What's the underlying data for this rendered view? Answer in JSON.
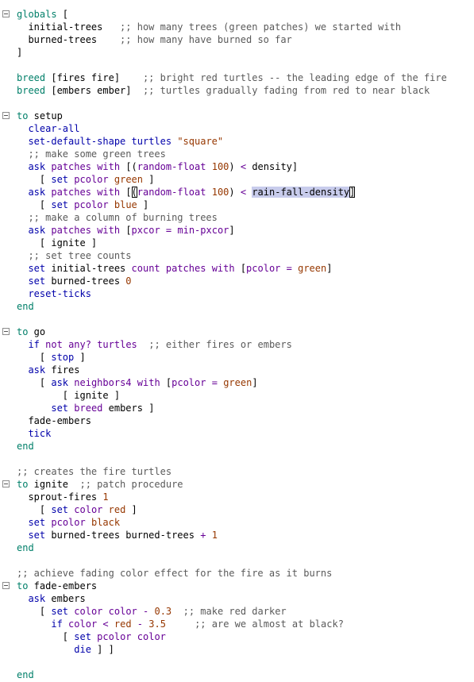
{
  "editor": {
    "colors": {
      "keyword": "#007f69",
      "command": "#0000aa",
      "reporter": "#660096",
      "constant": "#963700",
      "comment": "#5a5a5a",
      "text": "#000000",
      "selection": "#c8ccec"
    },
    "lines": [
      {
        "fold": true,
        "tokens": [
          {
            "t": "kw",
            "s": "globals"
          },
          {
            "t": "text",
            "s": " ["
          }
        ]
      },
      {
        "tokens": [
          {
            "t": "text",
            "s": "  initial-trees   "
          },
          {
            "t": "comment",
            "s": ";; how many trees (green patches) we started with"
          }
        ]
      },
      {
        "tokens": [
          {
            "t": "text",
            "s": "  burned-trees    "
          },
          {
            "t": "comment",
            "s": ";; how many have burned so far"
          }
        ]
      },
      {
        "tokens": [
          {
            "t": "text",
            "s": "]"
          }
        ]
      },
      {
        "tokens": []
      },
      {
        "tokens": [
          {
            "t": "kw",
            "s": "breed"
          },
          {
            "t": "text",
            "s": " [fires fire]    "
          },
          {
            "t": "comment",
            "s": ";; bright red turtles -- the leading edge of the fire"
          }
        ]
      },
      {
        "tokens": [
          {
            "t": "kw",
            "s": "breed"
          },
          {
            "t": "text",
            "s": " [embers ember]  "
          },
          {
            "t": "comment",
            "s": ";; turtles gradually fading from red to near black"
          }
        ]
      },
      {
        "tokens": []
      },
      {
        "fold": true,
        "tokens": [
          {
            "t": "kw",
            "s": "to"
          },
          {
            "t": "text",
            "s": " setup"
          }
        ]
      },
      {
        "tokens": [
          {
            "t": "text",
            "s": "  "
          },
          {
            "t": "cmd",
            "s": "clear-all"
          }
        ]
      },
      {
        "tokens": [
          {
            "t": "text",
            "s": "  "
          },
          {
            "t": "cmd",
            "s": "set-default-shape"
          },
          {
            "t": "text",
            "s": " "
          },
          {
            "t": "cmd",
            "s": "turtles"
          },
          {
            "t": "text",
            "s": " "
          },
          {
            "t": "const",
            "s": "\"square\""
          }
        ]
      },
      {
        "tokens": [
          {
            "t": "text",
            "s": "  "
          },
          {
            "t": "comment",
            "s": ";; make some green trees"
          }
        ]
      },
      {
        "tokens": [
          {
            "t": "text",
            "s": "  "
          },
          {
            "t": "cmd",
            "s": "ask"
          },
          {
            "t": "text",
            "s": " "
          },
          {
            "t": "rep",
            "s": "patches"
          },
          {
            "t": "text",
            "s": " "
          },
          {
            "t": "rep",
            "s": "with"
          },
          {
            "t": "text",
            "s": " [("
          },
          {
            "t": "rep",
            "s": "random-float"
          },
          {
            "t": "text",
            "s": " "
          },
          {
            "t": "const",
            "s": "100"
          },
          {
            "t": "text",
            "s": ") "
          },
          {
            "t": "rep",
            "s": "<"
          },
          {
            "t": "text",
            "s": " density]"
          }
        ]
      },
      {
        "tokens": [
          {
            "t": "text",
            "s": "    [ "
          },
          {
            "t": "cmd",
            "s": "set"
          },
          {
            "t": "text",
            "s": " "
          },
          {
            "t": "rep",
            "s": "pcolor"
          },
          {
            "t": "text",
            "s": " "
          },
          {
            "t": "const",
            "s": "green"
          },
          {
            "t": "text",
            "s": " ]"
          }
        ]
      },
      {
        "tokens": [
          {
            "t": "text",
            "s": "  "
          },
          {
            "t": "cmd",
            "s": "ask"
          },
          {
            "t": "text",
            "s": " "
          },
          {
            "t": "rep",
            "s": "patches"
          },
          {
            "t": "text",
            "s": " "
          },
          {
            "t": "rep",
            "s": "with"
          },
          {
            "t": "text",
            "s": " ["
          },
          {
            "t": "match",
            "s": "("
          },
          {
            "t": "rep",
            "s": "random-float"
          },
          {
            "t": "text",
            "s": " "
          },
          {
            "t": "const",
            "s": "100"
          },
          {
            "t": "text",
            "s": ") "
          },
          {
            "t": "rep",
            "s": "<"
          },
          {
            "t": "text",
            "s": " "
          },
          {
            "t": "sel",
            "s": "rain-fall-density"
          },
          {
            "t": "match",
            "s": "]"
          }
        ]
      },
      {
        "tokens": [
          {
            "t": "text",
            "s": "    [ "
          },
          {
            "t": "cmd",
            "s": "set"
          },
          {
            "t": "text",
            "s": " "
          },
          {
            "t": "rep",
            "s": "pcolor"
          },
          {
            "t": "text",
            "s": " "
          },
          {
            "t": "const",
            "s": "blue"
          },
          {
            "t": "text",
            "s": " ]"
          }
        ]
      },
      {
        "tokens": [
          {
            "t": "text",
            "s": "  "
          },
          {
            "t": "comment",
            "s": ";; make a column of burning trees"
          }
        ]
      },
      {
        "tokens": [
          {
            "t": "text",
            "s": "  "
          },
          {
            "t": "cmd",
            "s": "ask"
          },
          {
            "t": "text",
            "s": " "
          },
          {
            "t": "rep",
            "s": "patches"
          },
          {
            "t": "text",
            "s": " "
          },
          {
            "t": "rep",
            "s": "with"
          },
          {
            "t": "text",
            "s": " ["
          },
          {
            "t": "rep",
            "s": "pxcor"
          },
          {
            "t": "text",
            "s": " "
          },
          {
            "t": "rep",
            "s": "="
          },
          {
            "t": "text",
            "s": " "
          },
          {
            "t": "rep",
            "s": "min-pxcor"
          },
          {
            "t": "text",
            "s": "]"
          }
        ]
      },
      {
        "tokens": [
          {
            "t": "text",
            "s": "    [ ignite ]"
          }
        ]
      },
      {
        "tokens": [
          {
            "t": "text",
            "s": "  "
          },
          {
            "t": "comment",
            "s": ";; set tree counts"
          }
        ]
      },
      {
        "tokens": [
          {
            "t": "text",
            "s": "  "
          },
          {
            "t": "cmd",
            "s": "set"
          },
          {
            "t": "text",
            "s": " initial-trees "
          },
          {
            "t": "rep",
            "s": "count"
          },
          {
            "t": "text",
            "s": " "
          },
          {
            "t": "rep",
            "s": "patches"
          },
          {
            "t": "text",
            "s": " "
          },
          {
            "t": "rep",
            "s": "with"
          },
          {
            "t": "text",
            "s": " ["
          },
          {
            "t": "rep",
            "s": "pcolor"
          },
          {
            "t": "text",
            "s": " "
          },
          {
            "t": "rep",
            "s": "="
          },
          {
            "t": "text",
            "s": " "
          },
          {
            "t": "const",
            "s": "green"
          },
          {
            "t": "text",
            "s": "]"
          }
        ]
      },
      {
        "tokens": [
          {
            "t": "text",
            "s": "  "
          },
          {
            "t": "cmd",
            "s": "set"
          },
          {
            "t": "text",
            "s": " burned-trees "
          },
          {
            "t": "const",
            "s": "0"
          }
        ]
      },
      {
        "tokens": [
          {
            "t": "text",
            "s": "  "
          },
          {
            "t": "cmd",
            "s": "reset-ticks"
          }
        ]
      },
      {
        "tokens": [
          {
            "t": "kw",
            "s": "end"
          }
        ]
      },
      {
        "tokens": []
      },
      {
        "fold": true,
        "tokens": [
          {
            "t": "kw",
            "s": "to"
          },
          {
            "t": "text",
            "s": " go"
          }
        ]
      },
      {
        "tokens": [
          {
            "t": "text",
            "s": "  "
          },
          {
            "t": "cmd",
            "s": "if"
          },
          {
            "t": "text",
            "s": " "
          },
          {
            "t": "rep",
            "s": "not"
          },
          {
            "t": "text",
            "s": " "
          },
          {
            "t": "rep",
            "s": "any?"
          },
          {
            "t": "text",
            "s": " "
          },
          {
            "t": "rep",
            "s": "turtles"
          },
          {
            "t": "text",
            "s": "  "
          },
          {
            "t": "comment",
            "s": ";; either fires or embers"
          }
        ]
      },
      {
        "tokens": [
          {
            "t": "text",
            "s": "    [ "
          },
          {
            "t": "cmd",
            "s": "stop"
          },
          {
            "t": "text",
            "s": " ]"
          }
        ]
      },
      {
        "tokens": [
          {
            "t": "text",
            "s": "  "
          },
          {
            "t": "cmd",
            "s": "ask"
          },
          {
            "t": "text",
            "s": " fires"
          }
        ]
      },
      {
        "tokens": [
          {
            "t": "text",
            "s": "    [ "
          },
          {
            "t": "cmd",
            "s": "ask"
          },
          {
            "t": "text",
            "s": " "
          },
          {
            "t": "rep",
            "s": "neighbors4"
          },
          {
            "t": "text",
            "s": " "
          },
          {
            "t": "rep",
            "s": "with"
          },
          {
            "t": "text",
            "s": " ["
          },
          {
            "t": "rep",
            "s": "pcolor"
          },
          {
            "t": "text",
            "s": " "
          },
          {
            "t": "rep",
            "s": "="
          },
          {
            "t": "text",
            "s": " "
          },
          {
            "t": "const",
            "s": "green"
          },
          {
            "t": "text",
            "s": "]"
          }
        ]
      },
      {
        "tokens": [
          {
            "t": "text",
            "s": "        [ ignite ]"
          }
        ]
      },
      {
        "tokens": [
          {
            "t": "text",
            "s": "      "
          },
          {
            "t": "cmd",
            "s": "set"
          },
          {
            "t": "text",
            "s": " "
          },
          {
            "t": "rep",
            "s": "breed"
          },
          {
            "t": "text",
            "s": " embers ]"
          }
        ]
      },
      {
        "tokens": [
          {
            "t": "text",
            "s": "  fade-embers"
          }
        ]
      },
      {
        "tokens": [
          {
            "t": "text",
            "s": "  "
          },
          {
            "t": "cmd",
            "s": "tick"
          }
        ]
      },
      {
        "tokens": [
          {
            "t": "kw",
            "s": "end"
          }
        ]
      },
      {
        "tokens": []
      },
      {
        "tokens": [
          {
            "t": "comment",
            "s": ";; creates the fire turtles"
          }
        ]
      },
      {
        "fold": true,
        "tokens": [
          {
            "t": "kw",
            "s": "to"
          },
          {
            "t": "text",
            "s": " ignite  "
          },
          {
            "t": "comment",
            "s": ";; patch procedure"
          }
        ]
      },
      {
        "tokens": [
          {
            "t": "text",
            "s": "  sprout-fires "
          },
          {
            "t": "const",
            "s": "1"
          }
        ]
      },
      {
        "tokens": [
          {
            "t": "text",
            "s": "    [ "
          },
          {
            "t": "cmd",
            "s": "set"
          },
          {
            "t": "text",
            "s": " "
          },
          {
            "t": "rep",
            "s": "color"
          },
          {
            "t": "text",
            "s": " "
          },
          {
            "t": "const",
            "s": "red"
          },
          {
            "t": "text",
            "s": " ]"
          }
        ]
      },
      {
        "tokens": [
          {
            "t": "text",
            "s": "  "
          },
          {
            "t": "cmd",
            "s": "set"
          },
          {
            "t": "text",
            "s": " "
          },
          {
            "t": "rep",
            "s": "pcolor"
          },
          {
            "t": "text",
            "s": " "
          },
          {
            "t": "const",
            "s": "black"
          }
        ]
      },
      {
        "tokens": [
          {
            "t": "text",
            "s": "  "
          },
          {
            "t": "cmd",
            "s": "set"
          },
          {
            "t": "text",
            "s": " burned-trees burned-trees "
          },
          {
            "t": "rep",
            "s": "+"
          },
          {
            "t": "text",
            "s": " "
          },
          {
            "t": "const",
            "s": "1"
          }
        ]
      },
      {
        "tokens": [
          {
            "t": "kw",
            "s": "end"
          }
        ]
      },
      {
        "tokens": []
      },
      {
        "tokens": [
          {
            "t": "comment",
            "s": ";; achieve fading color effect for the fire as it burns"
          }
        ]
      },
      {
        "fold": true,
        "tokens": [
          {
            "t": "kw",
            "s": "to"
          },
          {
            "t": "text",
            "s": " fade-embers"
          }
        ]
      },
      {
        "tokens": [
          {
            "t": "text",
            "s": "  "
          },
          {
            "t": "cmd",
            "s": "ask"
          },
          {
            "t": "text",
            "s": " embers"
          }
        ]
      },
      {
        "tokens": [
          {
            "t": "text",
            "s": "    [ "
          },
          {
            "t": "cmd",
            "s": "set"
          },
          {
            "t": "text",
            "s": " "
          },
          {
            "t": "rep",
            "s": "color"
          },
          {
            "t": "text",
            "s": " "
          },
          {
            "t": "rep",
            "s": "color"
          },
          {
            "t": "text",
            "s": " "
          },
          {
            "t": "rep",
            "s": "-"
          },
          {
            "t": "text",
            "s": " "
          },
          {
            "t": "const",
            "s": "0.3"
          },
          {
            "t": "text",
            "s": "  "
          },
          {
            "t": "comment",
            "s": ";; make red darker"
          }
        ]
      },
      {
        "tokens": [
          {
            "t": "text",
            "s": "      "
          },
          {
            "t": "cmd",
            "s": "if"
          },
          {
            "t": "text",
            "s": " "
          },
          {
            "t": "rep",
            "s": "color"
          },
          {
            "t": "text",
            "s": " "
          },
          {
            "t": "rep",
            "s": "<"
          },
          {
            "t": "text",
            "s": " "
          },
          {
            "t": "const",
            "s": "red"
          },
          {
            "t": "text",
            "s": " "
          },
          {
            "t": "rep",
            "s": "-"
          },
          {
            "t": "text",
            "s": " "
          },
          {
            "t": "const",
            "s": "3.5"
          },
          {
            "t": "text",
            "s": "     "
          },
          {
            "t": "comment",
            "s": ";; are we almost at black?"
          }
        ]
      },
      {
        "tokens": [
          {
            "t": "text",
            "s": "        [ "
          },
          {
            "t": "cmd",
            "s": "set"
          },
          {
            "t": "text",
            "s": " "
          },
          {
            "t": "rep",
            "s": "pcolor"
          },
          {
            "t": "text",
            "s": " "
          },
          {
            "t": "rep",
            "s": "color"
          }
        ]
      },
      {
        "tokens": [
          {
            "t": "text",
            "s": "          "
          },
          {
            "t": "cmd",
            "s": "die"
          },
          {
            "t": "text",
            "s": " ] ]"
          }
        ]
      },
      {
        "tokens": []
      },
      {
        "tokens": [
          {
            "t": "kw",
            "s": "end"
          }
        ]
      }
    ]
  }
}
